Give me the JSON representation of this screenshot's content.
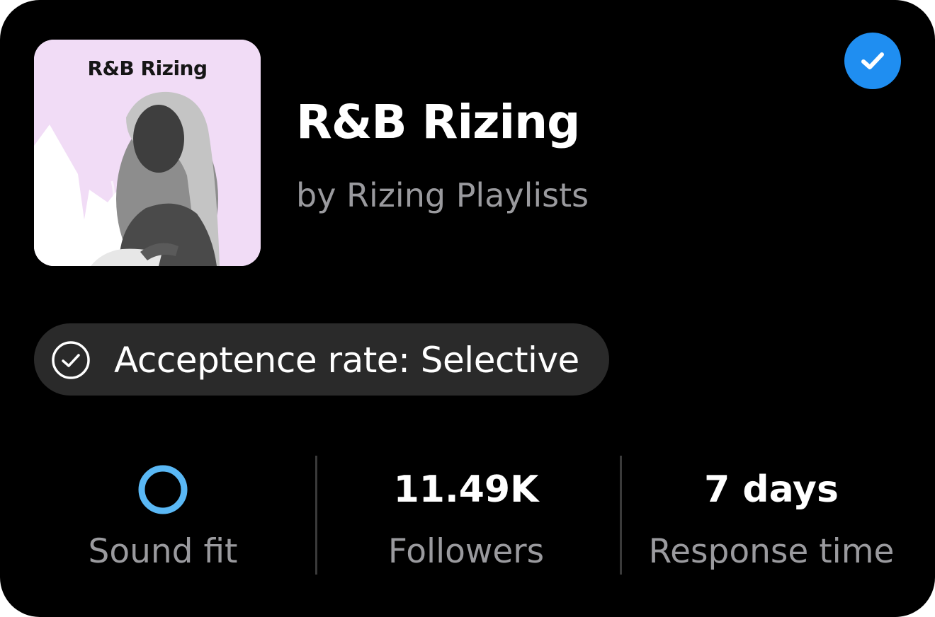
{
  "playlist": {
    "cover_title": "R&B Rizing",
    "title": "R&B Rizing",
    "owner": "by Rizing Playlists",
    "verified_icon": "check-circle-icon",
    "verified_color": "#1f8ef1"
  },
  "acceptance": {
    "icon": "check-circle-outline-icon",
    "label": "Acceptence rate: Selective"
  },
  "stats": {
    "sound_fit": {
      "icon": "ring-icon",
      "color": "#5ab8f5",
      "label": "Sound fit"
    },
    "followers": {
      "value": "11.49K",
      "label": "Followers"
    },
    "response_time": {
      "value": "7 days",
      "label": "Response time"
    }
  },
  "colors": {
    "background": "#000000",
    "pill": "#2a2a2a",
    "muted_text": "#9a9a9e",
    "cover_bg": "#f1dcf6"
  }
}
